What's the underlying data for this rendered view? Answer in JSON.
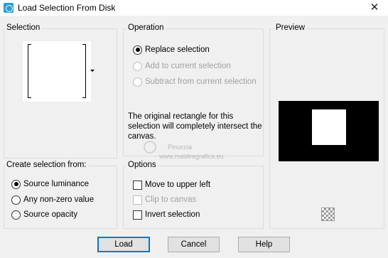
{
  "window": {
    "title": "Load Selection From Disk",
    "close_glyph": "✕"
  },
  "selection": {
    "label": "Selection"
  },
  "operation": {
    "label": "Operation",
    "options": [
      {
        "label": "Replace selection",
        "selected": true,
        "enabled": true
      },
      {
        "label": "Add to current selection",
        "selected": false,
        "enabled": false
      },
      {
        "label": "Subtract from current selection",
        "selected": false,
        "enabled": false
      }
    ],
    "info": "The original rectangle for this selection will completely intersect the canvas."
  },
  "preview": {
    "label": "Preview"
  },
  "create_from": {
    "label": "Create selection from:",
    "options": [
      {
        "label": "Source luminance",
        "selected": true
      },
      {
        "label": "Any non-zero value",
        "selected": false
      },
      {
        "label": "Source opacity",
        "selected": false
      }
    ]
  },
  "options": {
    "label": "Options",
    "items": [
      {
        "label": "Move to upper left",
        "checked": false,
        "enabled": true
      },
      {
        "label": "Clip to canvas",
        "checked": false,
        "enabled": false
      },
      {
        "label": "Invert selection",
        "checked": false,
        "enabled": true
      }
    ]
  },
  "watermark": {
    "line1": "Pinuccia",
    "line2": "www.maldiregrafica.eu"
  },
  "buttons": {
    "load": "Load",
    "cancel": "Cancel",
    "help": "Help"
  }
}
